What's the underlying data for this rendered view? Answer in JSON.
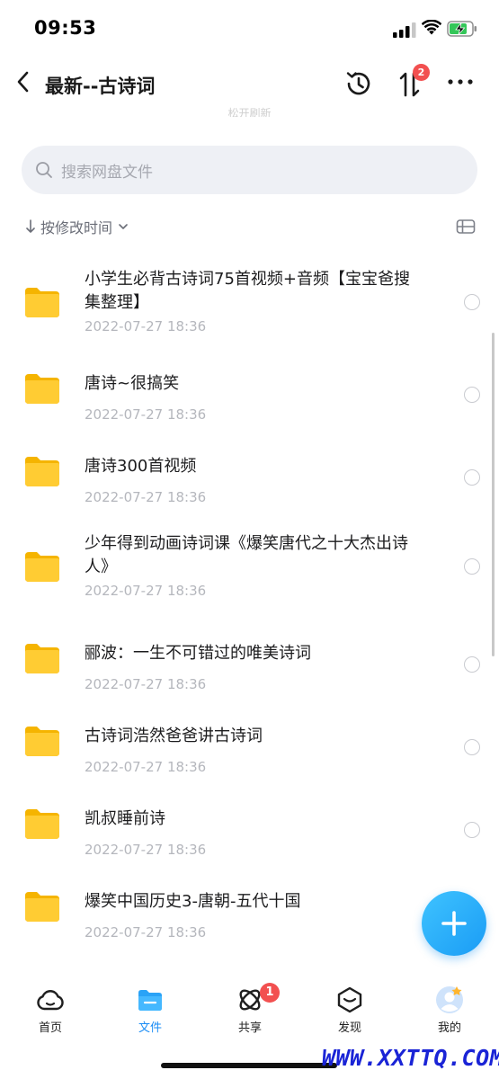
{
  "status_bar": {
    "time": "09:53"
  },
  "nav": {
    "title": "最新--古诗词",
    "transfer_badge": "2"
  },
  "pull_hint": "松开刷新",
  "search": {
    "placeholder": "搜索网盘文件"
  },
  "sort": {
    "label": "按修改时间"
  },
  "files": [
    {
      "name": "小学生必背古诗词75首视频+音频【宝宝爸搜集整理】",
      "date": "2022-07-27 18:36"
    },
    {
      "name": "唐诗~很搞笑",
      "date": "2022-07-27 18:36"
    },
    {
      "name": "唐诗300首视频",
      "date": "2022-07-27 18:36"
    },
    {
      "name": "少年得到动画诗词课《爆笑唐代之十大杰出诗人》",
      "date": "2022-07-27 18:36"
    },
    {
      "name": "郦波：一生不可错过的唯美诗词",
      "date": "2022-07-27 18:36"
    },
    {
      "name": "古诗词浩然爸爸讲古诗词",
      "date": "2022-07-27 18:36"
    },
    {
      "name": "凯叔睡前诗",
      "date": "2022-07-27 18:36"
    },
    {
      "name": "爆笑中国历史3-唐朝-五代十国",
      "date": "2022-07-27 18:36"
    }
  ],
  "tabs": [
    {
      "label": "首页"
    },
    {
      "label": "文件"
    },
    {
      "label": "共享",
      "badge": "1"
    },
    {
      "label": "发现"
    },
    {
      "label": "我的"
    }
  ],
  "watermark": "WWW.XXTTQ.COM",
  "colors": {
    "accent": "#1a8cf5",
    "badge": "#f25050",
    "folder": "#ffc82c"
  }
}
